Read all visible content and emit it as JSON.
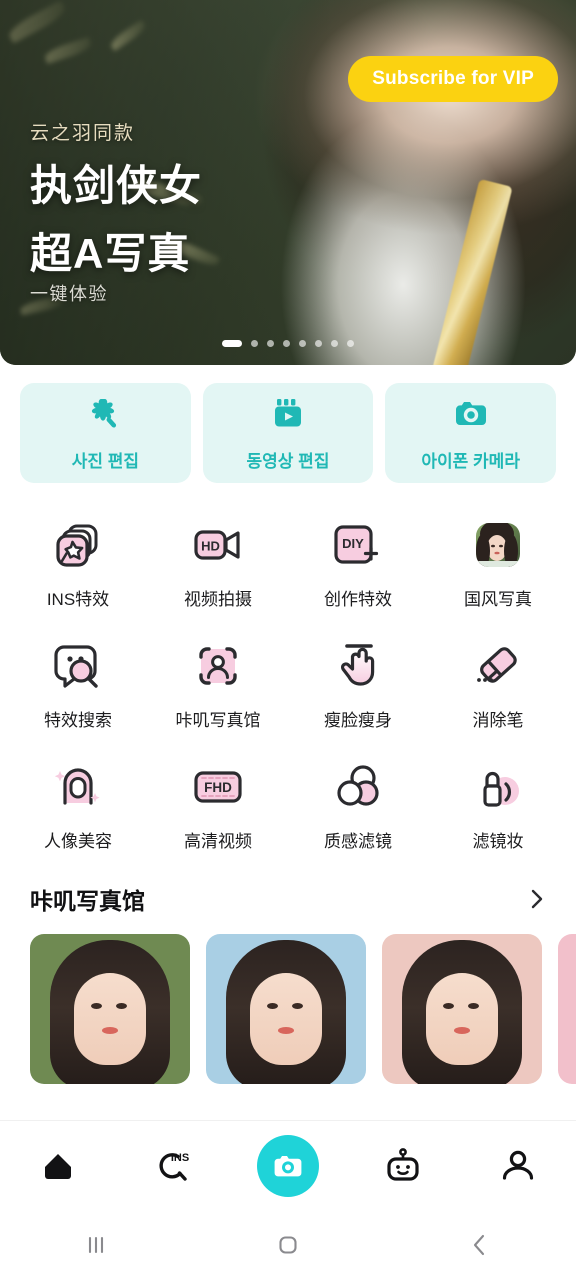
{
  "hero": {
    "kicker": "云之羽同款",
    "title_line1": "执剑侠女",
    "title_line2": "超A写真",
    "subtitle": "一键体验",
    "vip_button": "Subscribe for VIP",
    "vip_button_color": "#fbd211",
    "dots_total": 8,
    "dots_active_index": 0
  },
  "quick_cards": {
    "accent_color": "#20b8b5",
    "background_color": "#e3f6f4",
    "items": [
      {
        "label": "사진 편집",
        "icon": "magic-wand-icon"
      },
      {
        "label": "동영상 편집",
        "icon": "video-clip-icon"
      },
      {
        "label": "아이폰 카메라",
        "icon": "camera-icon"
      }
    ]
  },
  "features": {
    "rows": [
      [
        {
          "label": "INS特效",
          "icon": "stacked-cards-star-icon"
        },
        {
          "label": "视频拍摄",
          "icon": "hd-camcorder-icon"
        },
        {
          "label": "创作特效",
          "icon": "diy-plus-icon"
        },
        {
          "label": "国风写真",
          "icon": "portrait-thumbnail-icon"
        }
      ],
      [
        {
          "label": "特效搜索",
          "icon": "face-search-icon"
        },
        {
          "label": "咔叽写真馆",
          "icon": "portrait-scan-icon"
        },
        {
          "label": "瘦脸瘦身",
          "icon": "pinch-hand-icon"
        },
        {
          "label": "消除笔",
          "icon": "eraser-icon"
        }
      ],
      [
        {
          "label": "人像美容",
          "icon": "beauty-face-icon"
        },
        {
          "label": "高清视频",
          "icon": "fhd-icon"
        },
        {
          "label": "质感滤镜",
          "icon": "three-circles-filter-icon"
        },
        {
          "label": "滤镜妆",
          "icon": "lipstick-icon"
        }
      ]
    ],
    "icon_fill_color": "#f7cde0",
    "icon_stroke_color": "#2b2b2f",
    "label_color": "#1d1d1f"
  },
  "gallery": {
    "title": "咔叽写真馆",
    "more_icon": "chevron-right-icon",
    "cards": [
      {
        "background": "#6f8a52"
      },
      {
        "background": "#a9cfe4"
      },
      {
        "background": "#edc8c0"
      },
      {
        "background": "#f2c0cb"
      }
    ]
  },
  "bottom_nav": {
    "active_index": 2,
    "accent_color": "#1fd3d8",
    "items": [
      {
        "icon": "home-icon",
        "active": true
      },
      {
        "icon": "ins-search-icon",
        "active": false
      },
      {
        "icon": "camera-shutter-icon",
        "active": true
      },
      {
        "icon": "robot-icon",
        "active": false
      },
      {
        "icon": "profile-icon",
        "active": false
      }
    ]
  },
  "system_bar": {
    "items": [
      {
        "icon": "recents-icon"
      },
      {
        "icon": "home-square-icon"
      },
      {
        "icon": "back-chevron-icon"
      }
    ]
  }
}
